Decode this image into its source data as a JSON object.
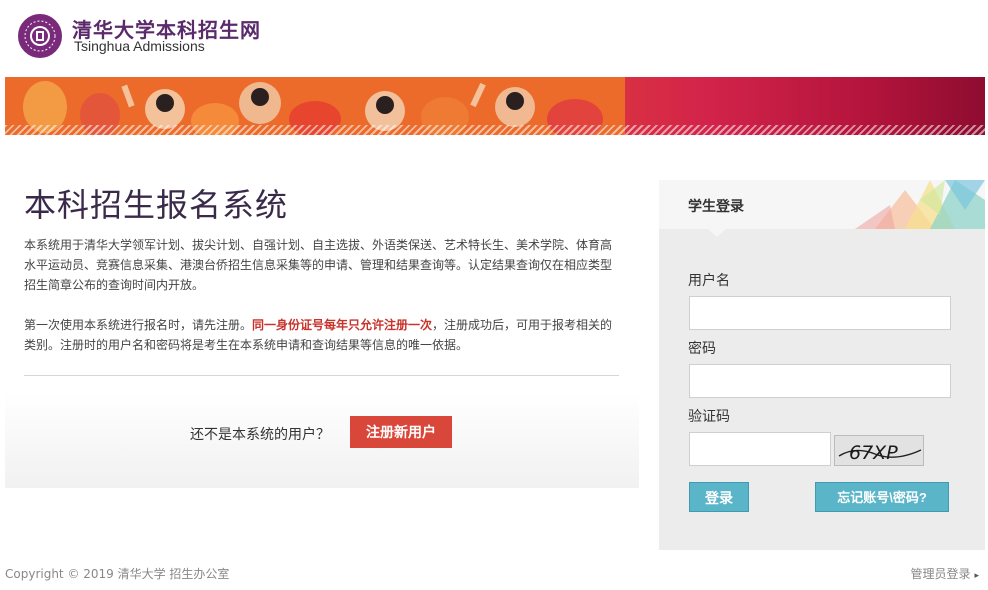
{
  "header": {
    "logo_cn": "清华大学本科招生网",
    "logo_en": "Tsinghua Admissions",
    "seal_icon": "tsinghua-seal-icon",
    "brand_color": "#5b2a6b"
  },
  "main": {
    "title": "本科招生报名系统",
    "intro": "本系统用于清华大学领军计划、拔尖计划、自强计划、自主选拔、外语类保送、艺术特长生、美术学院、体育高水平运动员、竞赛信息采集、港澳台侨招生信息采集等的申请、管理和结果查询等。认定结果查询仅在相应类型招生简章公布的查询时间内开放。",
    "notice_before": "第一次使用本系统进行报名时，请先注册。",
    "notice_highlight": "同一身份证号每年只允许注册一次",
    "notice_after": "，注册成功后，可用于报考相关的类别。注册时的用户名和密码将是考生在本系统申请和查询结果等信息的唯一依据。",
    "register_prompt": "还不是本系统的用户？",
    "register_button": "注册新用户",
    "highlight_color": "#c8332b",
    "register_color": "#d9473a"
  },
  "login": {
    "title": "学生登录",
    "username_label": "用户名",
    "username_value": "",
    "password_label": "密码",
    "password_value": "",
    "captcha_label": "验证码",
    "captcha_value": "",
    "captcha_text": "67XP",
    "login_button": "登录",
    "forgot_button": "忘记账号\\密码?",
    "button_color": "#5bb5c9"
  },
  "footer": {
    "copyright": "Copyright © 2019 清华大学 招生办公室",
    "admin_link": "管理员登录",
    "admin_arrow": "▸"
  }
}
